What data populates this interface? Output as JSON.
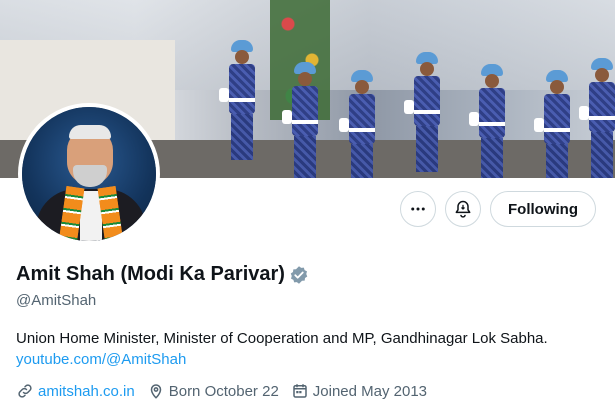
{
  "profile": {
    "display_name": "Amit Shah (Modi Ka Parivar)",
    "handle": "@AmitShah",
    "bio": "Union Home Minister, Minister of Cooperation and MP, Gandhinagar Lok Sabha.",
    "bio_link": "youtube.com/@AmitShah",
    "website": "amitshah.co.in",
    "birthday": "Born October 22",
    "joined": "Joined May 2013"
  },
  "actions": {
    "following_label": "Following"
  },
  "icons": {
    "more": "more-dots-icon",
    "notify": "bell-notification-icon",
    "verified": "verified-badge-icon",
    "link": "link-icon",
    "birthday": "location-pin-icon",
    "joined": "calendar-icon"
  },
  "colors": {
    "accent": "#1d9bf0",
    "secondary_text": "#536471",
    "verified_badge": "#829aab"
  }
}
